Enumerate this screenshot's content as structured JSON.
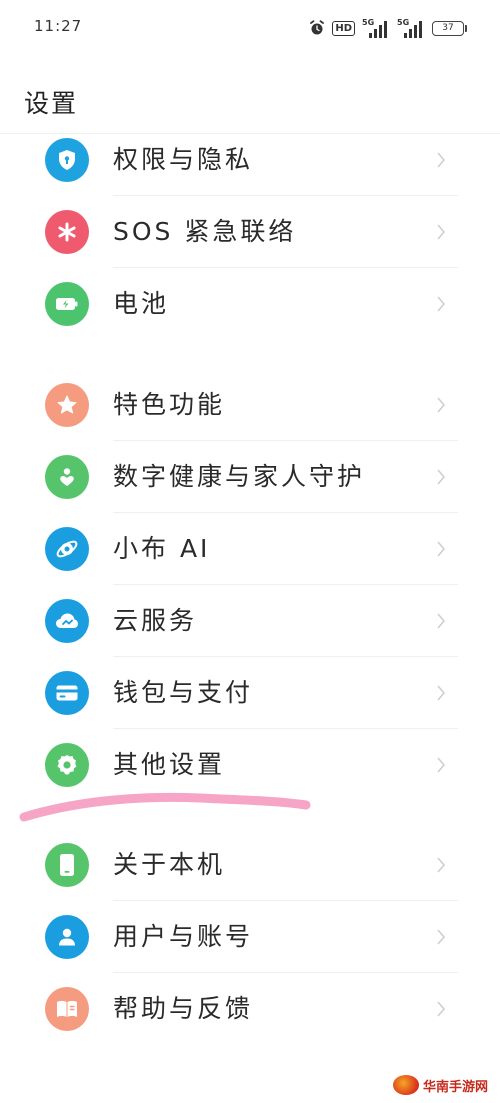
{
  "status_bar": {
    "time": "11:27",
    "hd_label": "HD",
    "signal1_label": "5G",
    "signal2_label": "5G",
    "battery": "37"
  },
  "page": {
    "title": "设置"
  },
  "settings_items": [
    {
      "label": "权限与隐私",
      "icon": "shield-icon",
      "color": "#1fa3e0"
    },
    {
      "label": "SOS 紧急联络",
      "icon": "asterisk-icon",
      "color": "#ef5a6f"
    },
    {
      "label": "电池",
      "icon": "battery-icon",
      "color": "#4cc46e"
    },
    {
      "label": "特色功能",
      "icon": "star-icon",
      "color": "#f59b7f"
    },
    {
      "label": "数字健康与家人守护",
      "icon": "heart-person-icon",
      "color": "#56c46b"
    },
    {
      "label": "小布 AI",
      "icon": "ai-assistant-icon",
      "color": "#1a9ee0"
    },
    {
      "label": "云服务",
      "icon": "cloud-icon",
      "color": "#1a9ee0"
    },
    {
      "label": "钱包与支付",
      "icon": "wallet-icon",
      "color": "#1a9ee0"
    },
    {
      "label": "其他设置",
      "icon": "gear-icon",
      "color": "#56c46b"
    },
    {
      "label": "关于本机",
      "icon": "phone-icon",
      "color": "#56c46b"
    },
    {
      "label": "用户与账号",
      "icon": "user-icon",
      "color": "#1a9ee0"
    },
    {
      "label": "帮助与反馈",
      "icon": "help-book-icon",
      "color": "#f59b7f"
    }
  ],
  "annotation": {
    "highlight_color": "#f59bc0"
  },
  "watermark": {
    "text": "华南手游网"
  }
}
